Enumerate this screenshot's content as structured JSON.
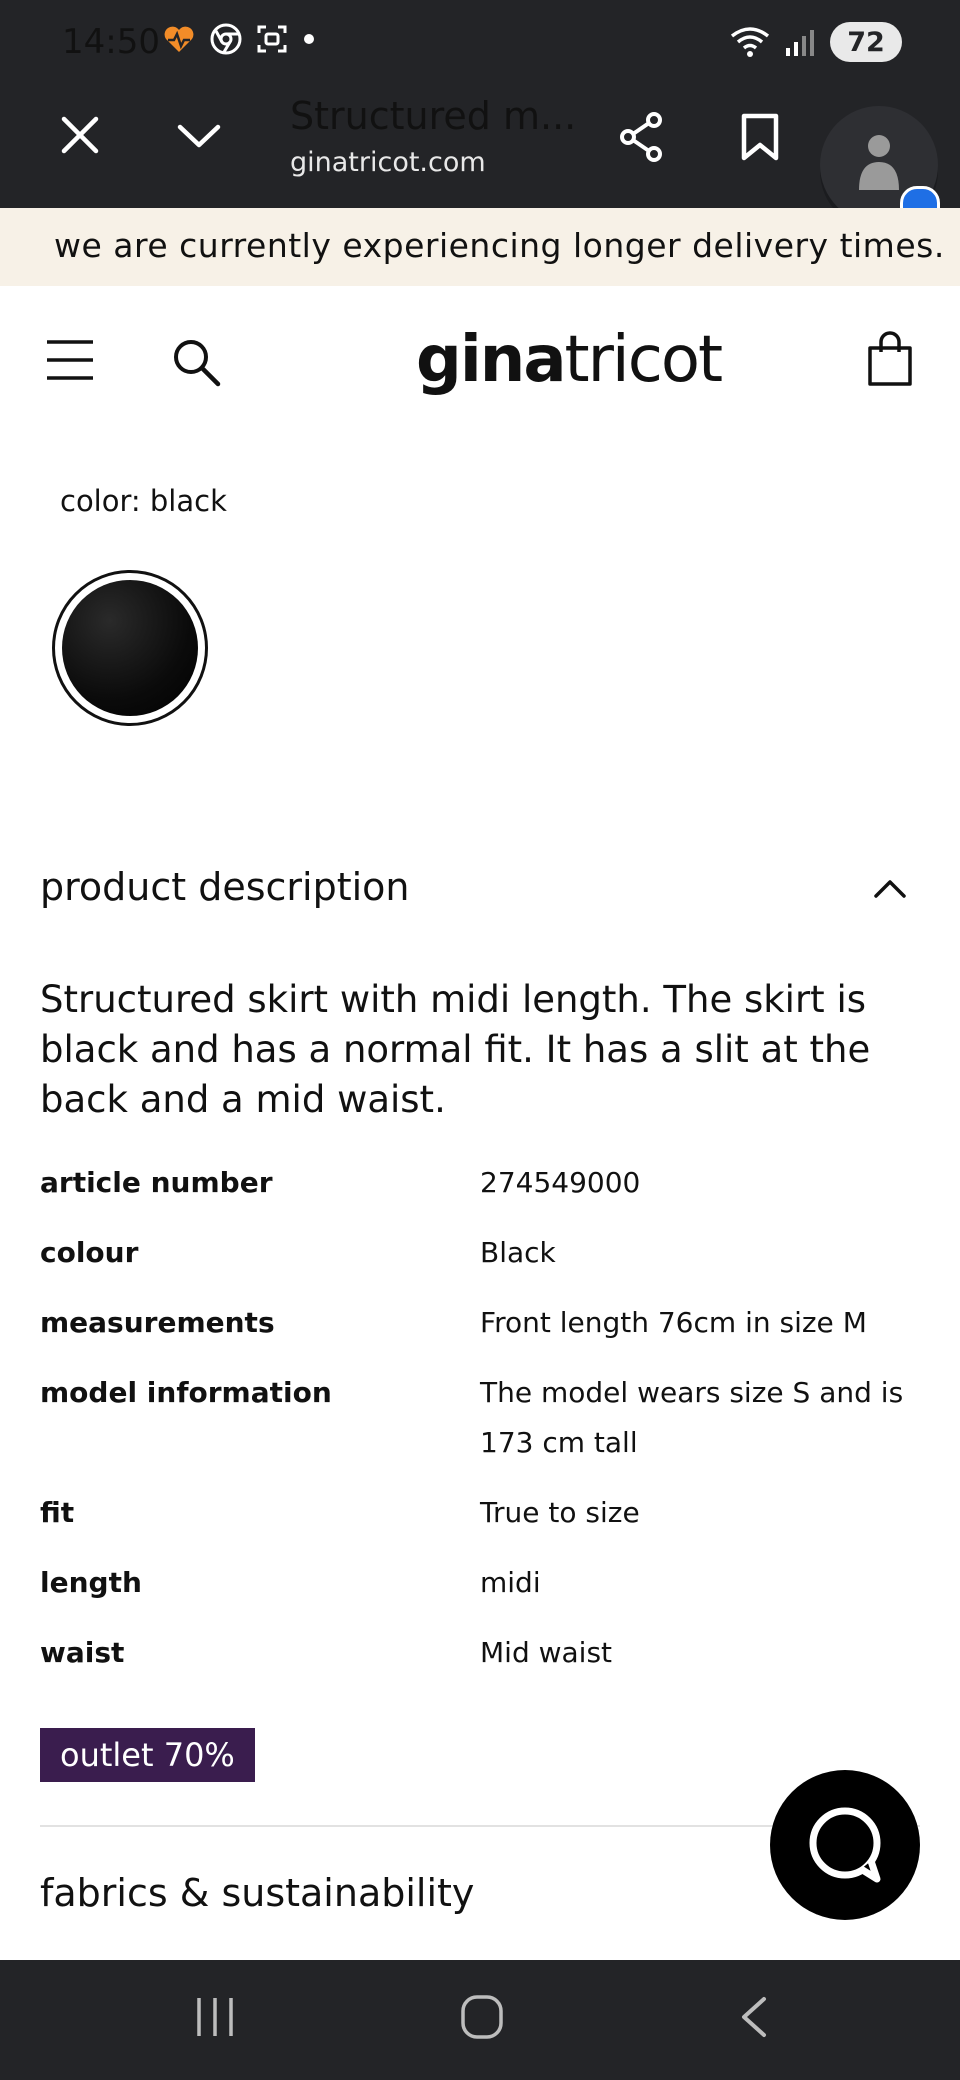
{
  "status_bar": {
    "time": "14:50",
    "battery": "72",
    "icons": [
      "heart-activity-icon",
      "chrome-icon",
      "screenshot-icon",
      "dot-icon",
      "wifi-icon",
      "signal-icon",
      "battery-icon"
    ]
  },
  "browser": {
    "tab_title": "Structured m...",
    "url": "ginatricot.com",
    "icons": [
      "close-icon",
      "chevron-down-icon",
      "share-icon",
      "bookmark-icon",
      "account-icon"
    ]
  },
  "banner": {
    "text": "we are currently experiencing longer delivery times."
  },
  "header": {
    "logo_bold": "gina",
    "logo_light": "tricot",
    "icons": [
      "menu-icon",
      "search-icon",
      "shopping-bag-icon"
    ]
  },
  "product": {
    "color_label": "color: black",
    "selected_swatch": "black",
    "description_heading": "product description",
    "description": "Structured skirt with midi length. The skirt is black and has a normal fit. It has a slit at the back and a mid waist.",
    "details": [
      {
        "key": "article number",
        "value": "274549000"
      },
      {
        "key": "colour",
        "value": "Black"
      },
      {
        "key": "measurements",
        "value": "Front length 76cm in size M"
      },
      {
        "key": "model information",
        "value": "The model wears size S and is 173 cm tall"
      },
      {
        "key": "fit",
        "value": "True to size"
      },
      {
        "key": "length",
        "value": "midi"
      },
      {
        "key": "waist",
        "value": "Mid waist"
      }
    ],
    "outlet_badge": "outlet 70%",
    "fabrics_heading": "fabrics & sustainability"
  },
  "colors": {
    "system_bar": "#232427",
    "banner_bg": "#f7f1e7",
    "outlet_badge_bg": "#3a1d4e",
    "chat_button": "#000000"
  },
  "nav": {
    "icons": [
      "recent-apps-icon",
      "home-icon",
      "back-icon"
    ]
  }
}
